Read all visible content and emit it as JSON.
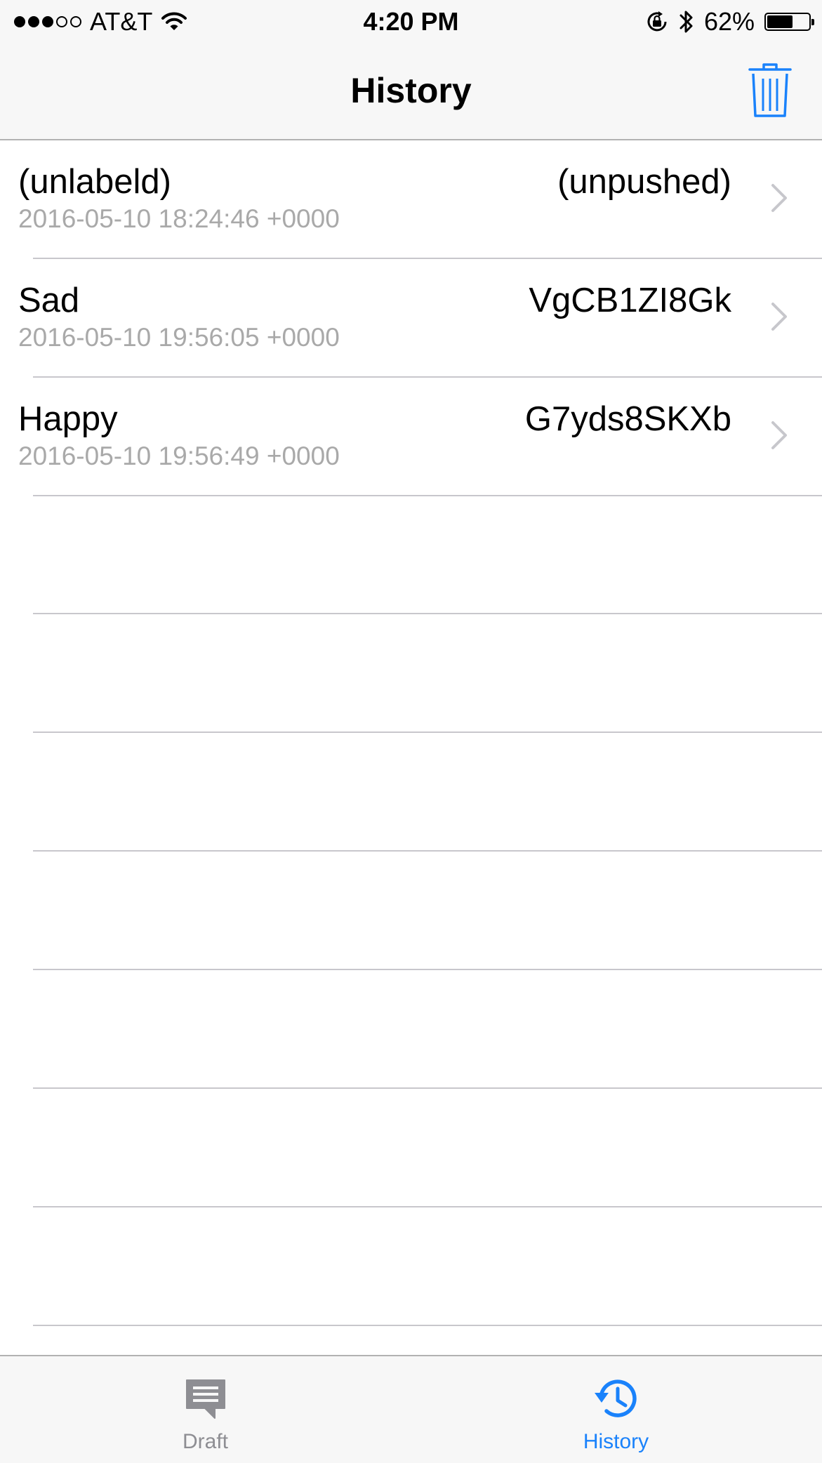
{
  "status_bar": {
    "carrier": "AT&T",
    "time": "4:20 PM",
    "battery_percent": "62%",
    "battery_level": 0.62,
    "signal_bars_filled": 3,
    "signal_bars_total": 5,
    "icons": [
      "wifi-icon",
      "rotation-lock-icon",
      "bluetooth-icon",
      "battery-icon"
    ]
  },
  "nav": {
    "title": "History",
    "right_button_icon": "trash-icon"
  },
  "history": {
    "rows": [
      {
        "label": "(unlabeld)",
        "date": "2016-05-10 18:24:46 +0000",
        "id": "(unpushed)"
      },
      {
        "label": "Sad",
        "date": "2016-05-10 19:56:05 +0000",
        "id": "VgCB1ZI8Gk"
      },
      {
        "label": "Happy",
        "date": "2016-05-10 19:56:49 +0000",
        "id": "G7yds8SKXb"
      }
    ]
  },
  "tab_bar": {
    "tabs": [
      {
        "label": "Draft",
        "icon": "message-icon",
        "selected": false
      },
      {
        "label": "History",
        "icon": "history-icon",
        "selected": true
      }
    ]
  },
  "colors": {
    "accent": "#1a82fb",
    "inactive_tab": "#8e8e93",
    "secondary_text": "#a9a9a9",
    "separator": "#c8c7cc",
    "bar_background": "#f7f7f7"
  }
}
